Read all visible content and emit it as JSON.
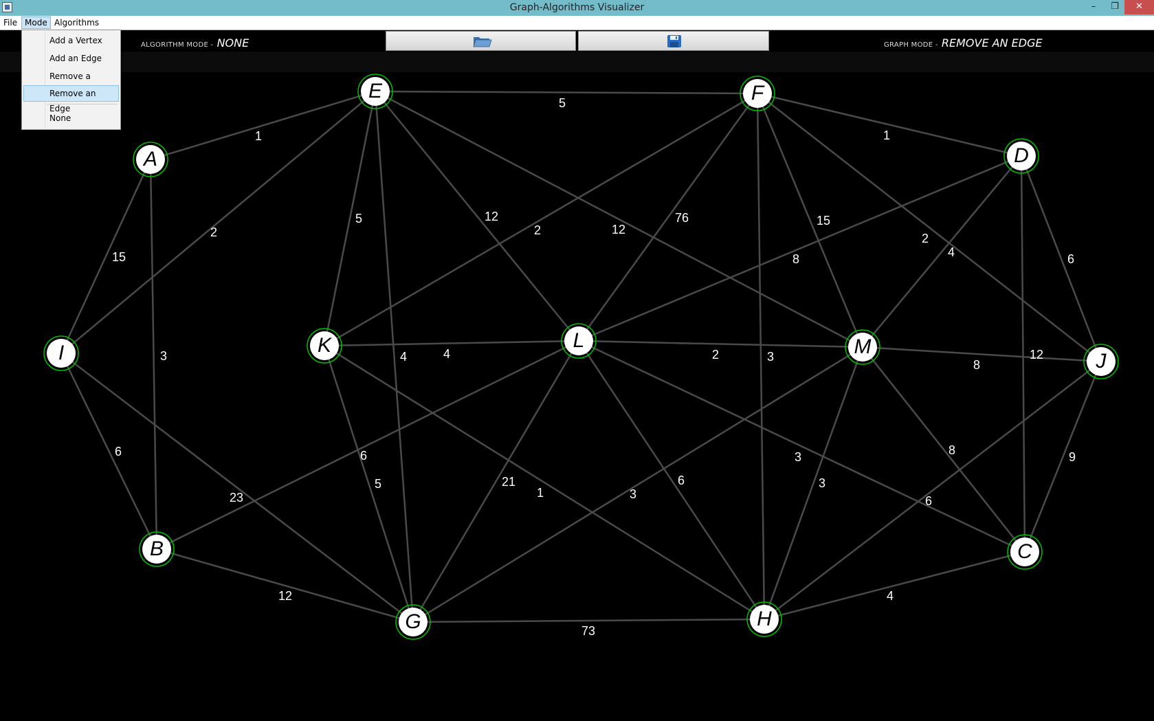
{
  "window": {
    "title": "Graph-Algorithms Visualizer",
    "controls": {
      "minimize": "–",
      "maximize": "❐",
      "close": "✕"
    }
  },
  "menubar": {
    "items": [
      {
        "label": "File"
      },
      {
        "label": "Mode",
        "open": true
      },
      {
        "label": "Algorithms"
      }
    ]
  },
  "mode_menu": {
    "items": [
      {
        "label": "Add a Vertex",
        "selected": false
      },
      {
        "label": "Add an Edge",
        "selected": false
      },
      {
        "label": "Remove a Vertex",
        "selected": false
      },
      {
        "label": "Remove an Edge",
        "selected": true
      },
      {
        "label": "None",
        "selected": false
      }
    ]
  },
  "toolbar": {
    "algorithm_mode_label": "Algorithm Mode -",
    "algorithm_mode_value": "NONE",
    "graph_mode_label": "Graph Mode -",
    "graph_mode_value": "REMOVE AN EDGE",
    "open_icon": "folder-open-icon",
    "save_icon": "floppy-disk-icon"
  },
  "colors": {
    "titlebar": "#75bccb",
    "canvas_background": "#000000",
    "edge": "#4a4a4a",
    "vertex_fill": "#ffffff",
    "vertex_ring": "#00c000",
    "weight_text": "#ffffff"
  },
  "graph": {
    "vertices": [
      "A",
      "B",
      "C",
      "D",
      "E",
      "F",
      "G",
      "H",
      "I",
      "J",
      "K",
      "L",
      "M"
    ],
    "edges": [
      {
        "from": "E",
        "to": "F",
        "weight": "5"
      },
      {
        "from": "A",
        "to": "E",
        "weight": "1"
      },
      {
        "from": "F",
        "to": "D",
        "weight": "1"
      },
      {
        "from": "I",
        "to": "E",
        "weight": "2"
      },
      {
        "from": "A",
        "to": "I",
        "weight": "15"
      },
      {
        "from": "A",
        "to": "B",
        "weight": "3"
      },
      {
        "from": "E",
        "to": "K",
        "weight": "5"
      },
      {
        "from": "E",
        "to": "L",
        "weight": "12"
      },
      {
        "from": "E",
        "to": "M",
        "weight": "12"
      },
      {
        "from": "E",
        "to": "G",
        "weight": "4"
      },
      {
        "from": "F",
        "to": "K",
        "weight": "2"
      },
      {
        "from": "F",
        "to": "L",
        "weight": "76"
      },
      {
        "from": "F",
        "to": "M",
        "weight": "15"
      },
      {
        "from": "F",
        "to": "J",
        "weight": "4"
      },
      {
        "from": "F",
        "to": "H",
        "weight": "3"
      },
      {
        "from": "D",
        "to": "L",
        "weight": "8"
      },
      {
        "from": "D",
        "to": "M",
        "weight": "2"
      },
      {
        "from": "D",
        "to": "J",
        "weight": "6"
      },
      {
        "from": "D",
        "to": "C",
        "weight": "12"
      },
      {
        "from": "K",
        "to": "L",
        "weight": "4"
      },
      {
        "from": "L",
        "to": "M",
        "weight": "2"
      },
      {
        "from": "M",
        "to": "J",
        "weight": "8"
      },
      {
        "from": "I",
        "to": "B",
        "weight": "6"
      },
      {
        "from": "I",
        "to": "G",
        "weight": "23"
      },
      {
        "from": "B",
        "to": "L",
        "weight": "6"
      },
      {
        "from": "B",
        "to": "G",
        "weight": "12"
      },
      {
        "from": "K",
        "to": "G",
        "weight": "5"
      },
      {
        "from": "K",
        "to": "H",
        "weight": "1"
      },
      {
        "from": "L",
        "to": "G",
        "weight": "21"
      },
      {
        "from": "L",
        "to": "H",
        "weight": "6"
      },
      {
        "from": "L",
        "to": "C",
        "weight": "3"
      },
      {
        "from": "M",
        "to": "G",
        "weight": "3"
      },
      {
        "from": "M",
        "to": "H",
        "weight": "3"
      },
      {
        "from": "M",
        "to": "C",
        "weight": "8"
      },
      {
        "from": "J",
        "to": "H",
        "weight": "6"
      },
      {
        "from": "J",
        "to": "C",
        "weight": "9"
      },
      {
        "from": "G",
        "to": "H",
        "weight": "73"
      },
      {
        "from": "H",
        "to": "C",
        "weight": "4"
      }
    ]
  }
}
